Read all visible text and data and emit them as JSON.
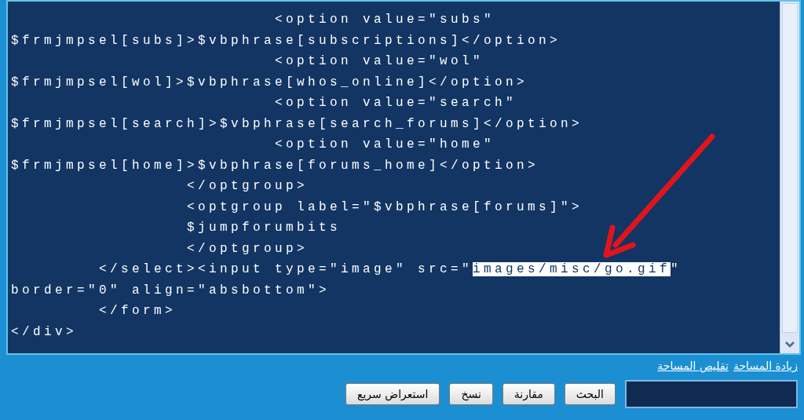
{
  "editor": {
    "lines": [
      [
        {
          "text": "                        <option value=\"subs\"",
          "selected": false
        }
      ],
      [
        {
          "text": "$frmjmpsel[subs]>$vbphrase[subscriptions]</option>",
          "selected": false
        }
      ],
      [
        {
          "text": "                        <option value=\"wol\"",
          "selected": false
        }
      ],
      [
        {
          "text": "$frmjmpsel[wol]>$vbphrase[whos_online]</option>",
          "selected": false
        }
      ],
      [
        {
          "text": "                        <option value=\"search\"",
          "selected": false
        }
      ],
      [
        {
          "text": "$frmjmpsel[search]>$vbphrase[search_forums]</option>",
          "selected": false
        }
      ],
      [
        {
          "text": "                        <option value=\"home\"",
          "selected": false
        }
      ],
      [
        {
          "text": "$frmjmpsel[home]>$vbphrase[forums_home]</option>",
          "selected": false
        }
      ],
      [
        {
          "text": "                </optgroup>",
          "selected": false
        }
      ],
      [
        {
          "text": "                <optgroup label=\"$vbphrase[forums]\">",
          "selected": false
        }
      ],
      [
        {
          "text": "                $jumpforumbits",
          "selected": false
        }
      ],
      [
        {
          "text": "                </optgroup>",
          "selected": false
        }
      ],
      [
        {
          "text": "        </select><input type=\"image\" src=\"",
          "selected": false
        },
        {
          "text": "images/misc/go.gif",
          "selected": true
        },
        {
          "text": "\"",
          "selected": false
        }
      ],
      [
        {
          "text": "border=\"0\" align=\"absbottom\">",
          "selected": false
        }
      ],
      [
        {
          "text": "        </form>",
          "selected": false
        }
      ],
      [
        {
          "text": "</div>",
          "selected": false
        }
      ]
    ]
  },
  "links": [
    "زيادة المساحة",
    "تقليص المساحة"
  ],
  "buttons": [
    "البحث",
    "مقارنة",
    "نسخ",
    "استعراض سريع"
  ]
}
